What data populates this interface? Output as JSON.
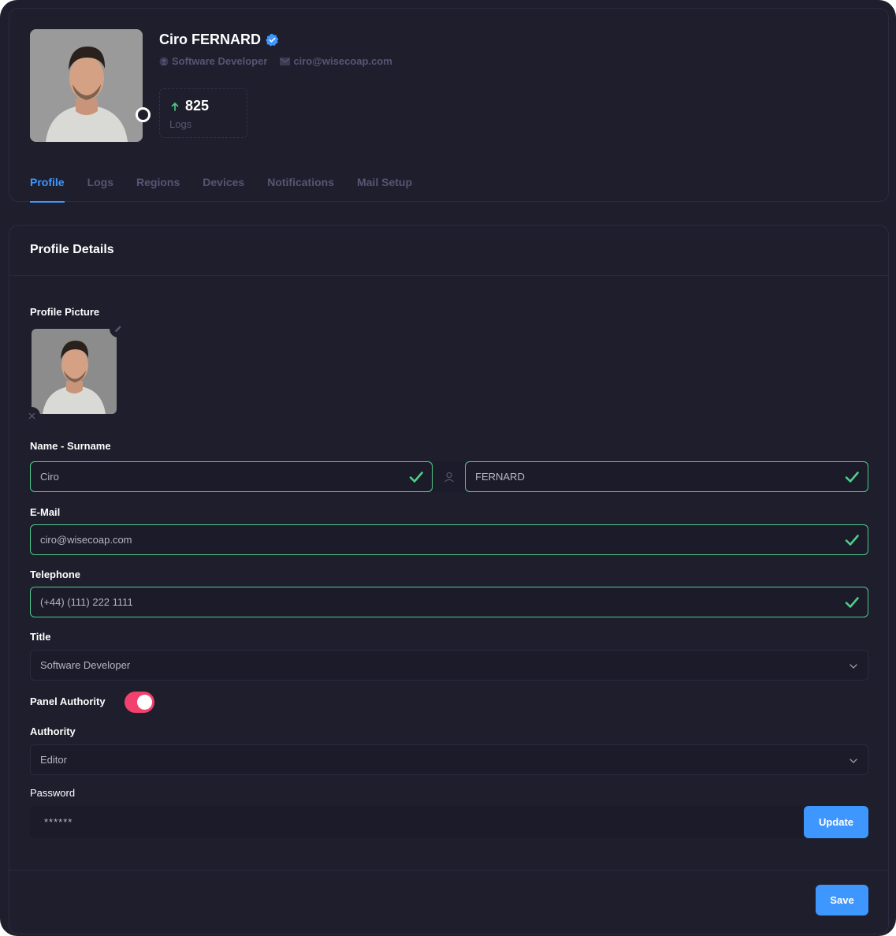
{
  "profile": {
    "name": "Ciro FERNARD",
    "role": "Software Developer",
    "email": "ciro@wisecoap.com",
    "stat_value": "825",
    "stat_label": "Logs"
  },
  "tabs": [
    {
      "label": "Profile",
      "active": true
    },
    {
      "label": "Logs",
      "active": false
    },
    {
      "label": "Regions",
      "active": false
    },
    {
      "label": "Devices",
      "active": false
    },
    {
      "label": "Notifications",
      "active": false
    },
    {
      "label": "Mail Setup",
      "active": false
    }
  ],
  "details": {
    "title": "Profile Details",
    "picture_label": "Profile Picture",
    "name_label": "Name - Surname",
    "first_name": "Ciro",
    "last_name": "FERNARD",
    "email_label": "E-Mail",
    "email_value": "ciro@wisecoap.com",
    "phone_label": "Telephone",
    "phone_value": "(+44) (111) 222 1111",
    "title_label": "Title",
    "title_value": "Software Developer",
    "panel_authority_label": "Panel Authority",
    "panel_authority_on": true,
    "authority_label": "Authority",
    "authority_value": "Editor",
    "password_label": "Password",
    "password_value": "******",
    "update_label": "Update",
    "save_label": "Save"
  },
  "colors": {
    "accent": "#3e97ff",
    "valid": "#50cd89",
    "toggle_on": "#f1416c",
    "background": "#1e1e2d"
  }
}
